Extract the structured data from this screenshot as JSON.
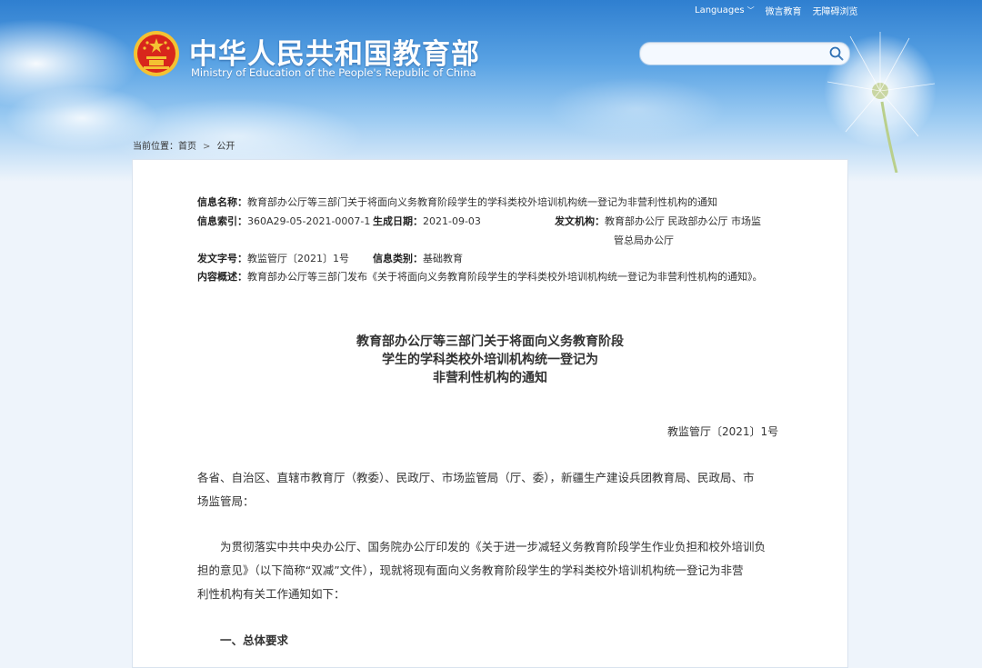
{
  "header": {
    "site_title": "中华人民共和国教育部",
    "site_subtitle": "Ministry of Education of the People's Republic of China",
    "nav": {
      "languages": "Languages",
      "weibo": "微言教育",
      "accessibility": "无障碍浏览"
    },
    "search_placeholder": ""
  },
  "breadcrumb": {
    "prefix": "当前位置：",
    "items": [
      "首页",
      "公开"
    ]
  },
  "meta": {
    "name_label": "信息名称：",
    "name_value": "教育部办公厅等三部门关于将面向义务教育阶段学生的学科类校外培训机构统一登记为非营利性机构的通知",
    "index_label": "信息索引：",
    "index_value": "360A29-05-2021-0007-1",
    "date_label": "生成日期：",
    "date_value": "2021-09-03",
    "issuer_label": "发文机构：",
    "issuer_line1": "教育部办公厅 民政部办公厅 市场监",
    "issuer_line2": "管总局办公厅",
    "docno_label": "发文字号：",
    "docno_value": "教监管厅〔2021〕1号",
    "category_label": "信息类别：",
    "category_value": "基础教育",
    "summary_label": "内容概述：",
    "summary_value": "教育部办公厅等三部门发布《关于将面向义务教育阶段学生的学科类校外培训机构统一登记为非营利性机构的通知》。"
  },
  "document": {
    "title_lines": [
      "教育部办公厅等三部门关于将面向义务教育阶段",
      "学生的学科类校外培训机构统一登记为",
      "非营利性机构的通知"
    ],
    "doc_number": "教监管厅〔2021〕1号",
    "addressee_lines": [
      "各省、自治区、直辖市教育厅（教委）、民政厅、市场监管局（厅、委），新疆生产建设兵团教育局、民政局、市",
      "场监管局："
    ],
    "intro_lines": [
      "　　为贯彻落实中共中央办公厅、国务院办公厅印发的《关于进一步减轻义务教育阶段学生作业负担和校外培训负",
      "担的意见》（以下简称“双减”文件），现就将现有面向义务教育阶段学生的学科类校外培训机构统一登记为非营",
      "利性机构有关工作通知如下："
    ],
    "section_heading": "一、总体要求"
  },
  "colors": {
    "banner_top": "#2f7fd0",
    "emblem_red": "#d8261c",
    "emblem_gold": "#f4c232"
  }
}
